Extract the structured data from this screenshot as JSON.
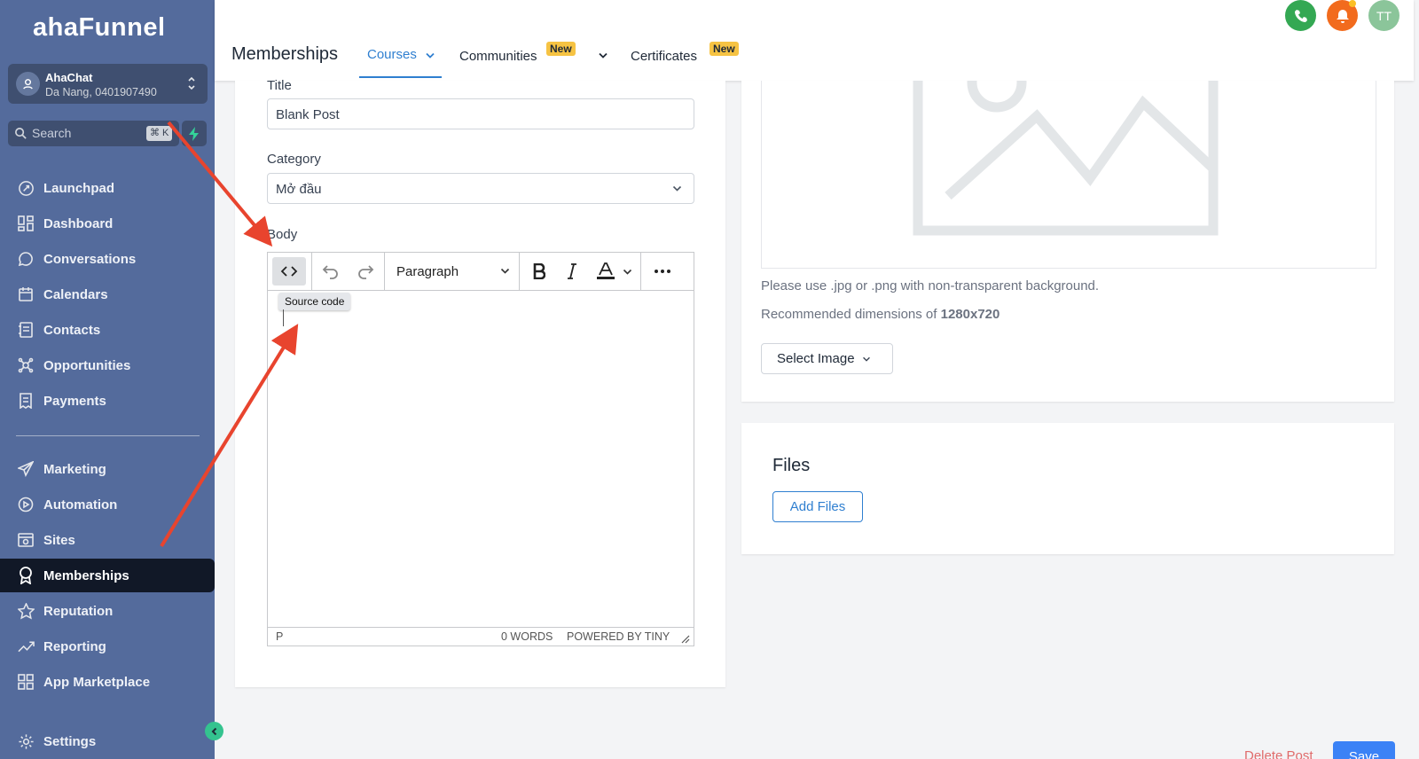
{
  "sidebar": {
    "logo": "ahaFunnel",
    "account": {
      "name": "AhaChat",
      "subtitle": "Da Nang, 0401907490"
    },
    "search": {
      "placeholder": "Search",
      "shortcut": "⌘ K"
    },
    "nav_top": [
      {
        "label": "Launchpad",
        "icon": "rocket-icon"
      },
      {
        "label": "Dashboard",
        "icon": "dashboard-icon"
      },
      {
        "label": "Conversations",
        "icon": "chat-bubble-icon"
      },
      {
        "label": "Calendars",
        "icon": "calendar-icon"
      },
      {
        "label": "Contacts",
        "icon": "contacts-book-icon"
      },
      {
        "label": "Opportunities",
        "icon": "opportunities-icon"
      },
      {
        "label": "Payments",
        "icon": "receipt-icon"
      }
    ],
    "nav_bottom": [
      {
        "label": "Marketing",
        "icon": "paper-plane-icon"
      },
      {
        "label": "Automation",
        "icon": "automation-icon"
      },
      {
        "label": "Sites",
        "icon": "sites-icon"
      },
      {
        "label": "Memberships",
        "icon": "award-icon",
        "active": true
      },
      {
        "label": "Reputation",
        "icon": "star-icon"
      },
      {
        "label": "Reporting",
        "icon": "trend-icon"
      },
      {
        "label": "App Marketplace",
        "icon": "grid-icon"
      }
    ],
    "settings_label": "Settings"
  },
  "header": {
    "title": "Memberships",
    "tabs": [
      {
        "label": "Courses",
        "active": true
      },
      {
        "label": "Communities",
        "badge": "New"
      },
      {
        "label": "Certificates",
        "badge": "New"
      }
    ],
    "avatar_initials": "TT"
  },
  "form": {
    "title_label": "Title",
    "title_value": "Blank Post",
    "category_label": "Category",
    "category_value": "Mở đầu",
    "body_label": "Body",
    "editor": {
      "block_format": "Paragraph",
      "tooltip": "Source code",
      "status_path": "P",
      "word_count": "0 WORDS",
      "powered_by": "POWERED BY TINY"
    }
  },
  "image_panel": {
    "note": "Please use .jpg or .png with non-transparent background.",
    "dimensions_prefix": "Recommended dimensions of ",
    "dimensions_value": "1280x720",
    "select_button": "Select Image"
  },
  "files_panel": {
    "title": "Files",
    "add_button": "Add Files"
  },
  "footer": {
    "delete_label": "Delete Post",
    "save_label": "Save"
  },
  "colors": {
    "sidebar": "#546b9c",
    "accent": "#2f7fd0",
    "annotation_arrow": "#e8442e",
    "badge": "#f6c343"
  }
}
